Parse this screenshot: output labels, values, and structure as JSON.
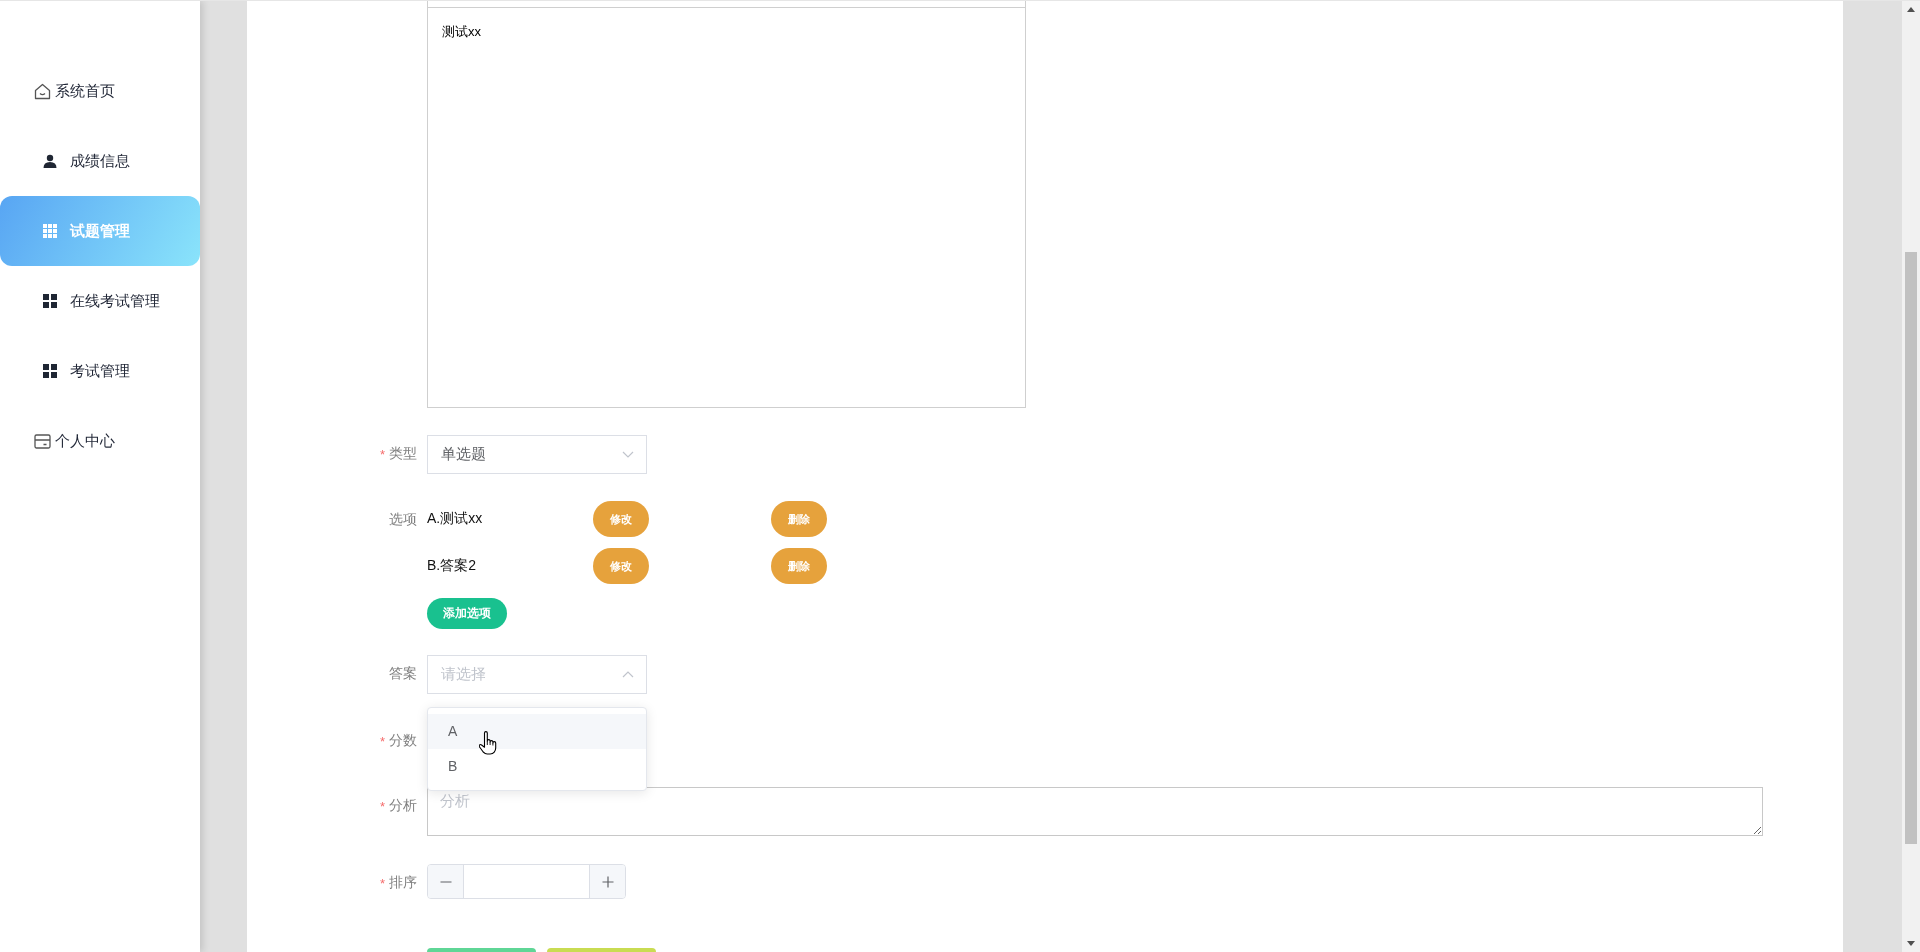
{
  "sidebar": {
    "items": [
      {
        "label": "系统首页",
        "kind": "home",
        "selected": false
      },
      {
        "label": "成绩信息",
        "kind": "person",
        "selected": false
      },
      {
        "label": "试题管理",
        "kind": "table",
        "selected": true
      },
      {
        "label": "在线考试管理",
        "kind": "grid",
        "selected": false
      },
      {
        "label": "考试管理",
        "kind": "grid",
        "selected": false
      },
      {
        "label": "个人中心",
        "kind": "card",
        "selected": false
      }
    ]
  },
  "editor": {
    "value": "测试xx"
  },
  "form": {
    "type": {
      "required_mark": "*",
      "label": "类型",
      "value": "单选题"
    },
    "options": {
      "label": "选项",
      "items": [
        {
          "text": "A.测试xx",
          "edit_button": "修改",
          "delete_button": "删除"
        },
        {
          "text": "B.答案2",
          "edit_button": "修改",
          "delete_button": "删除"
        }
      ],
      "add_button": "添加选项"
    },
    "answer": {
      "label": "答案",
      "placeholder": "请选择",
      "expanded": true,
      "dropdown": [
        {
          "label": "A",
          "hovered": true
        },
        {
          "label": "B",
          "hovered": false
        }
      ]
    },
    "score": {
      "required_mark": "*",
      "label": "分数"
    },
    "analysis": {
      "required_mark": "*",
      "label": "分析",
      "placeholder": "分析"
    },
    "sort": {
      "required_mark": "*",
      "label": "排序"
    }
  },
  "footer_buttons": [
    {
      "color": "#5fd696"
    },
    {
      "color": "#c9dc52"
    }
  ]
}
